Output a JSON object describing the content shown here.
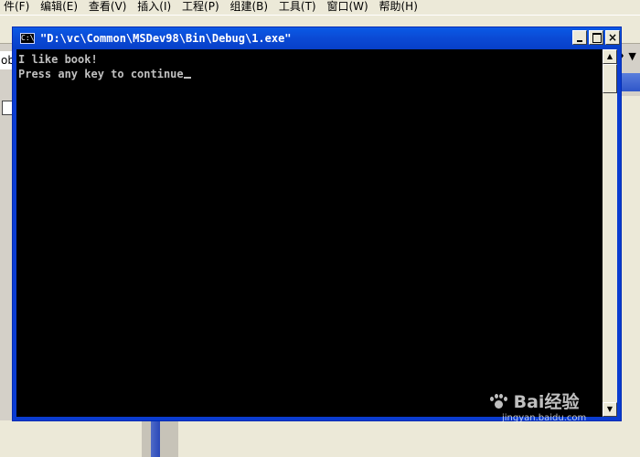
{
  "menubar": {
    "items": [
      "件(F)",
      "编辑(E)",
      "查看(V)",
      "插入(I)",
      "工程(P)",
      "组建(B)",
      "工具(T)",
      "窗口(W)",
      "帮助(H)"
    ]
  },
  "background": {
    "left_fragment": "ob",
    "right_fragment": "♦ ▼"
  },
  "console": {
    "title": "\"D:\\vc\\Common\\MSDev98\\Bin\\Debug\\1.exe\"",
    "icon_text": "C:\\",
    "output_lines": [
      "I like book!",
      "Press any key to continue"
    ],
    "caption_buttons": {
      "minimize": "_",
      "maximize": "□",
      "close": "×"
    }
  },
  "watermark": {
    "text": "Bai经验",
    "url": "jingyan.baidu.com"
  }
}
